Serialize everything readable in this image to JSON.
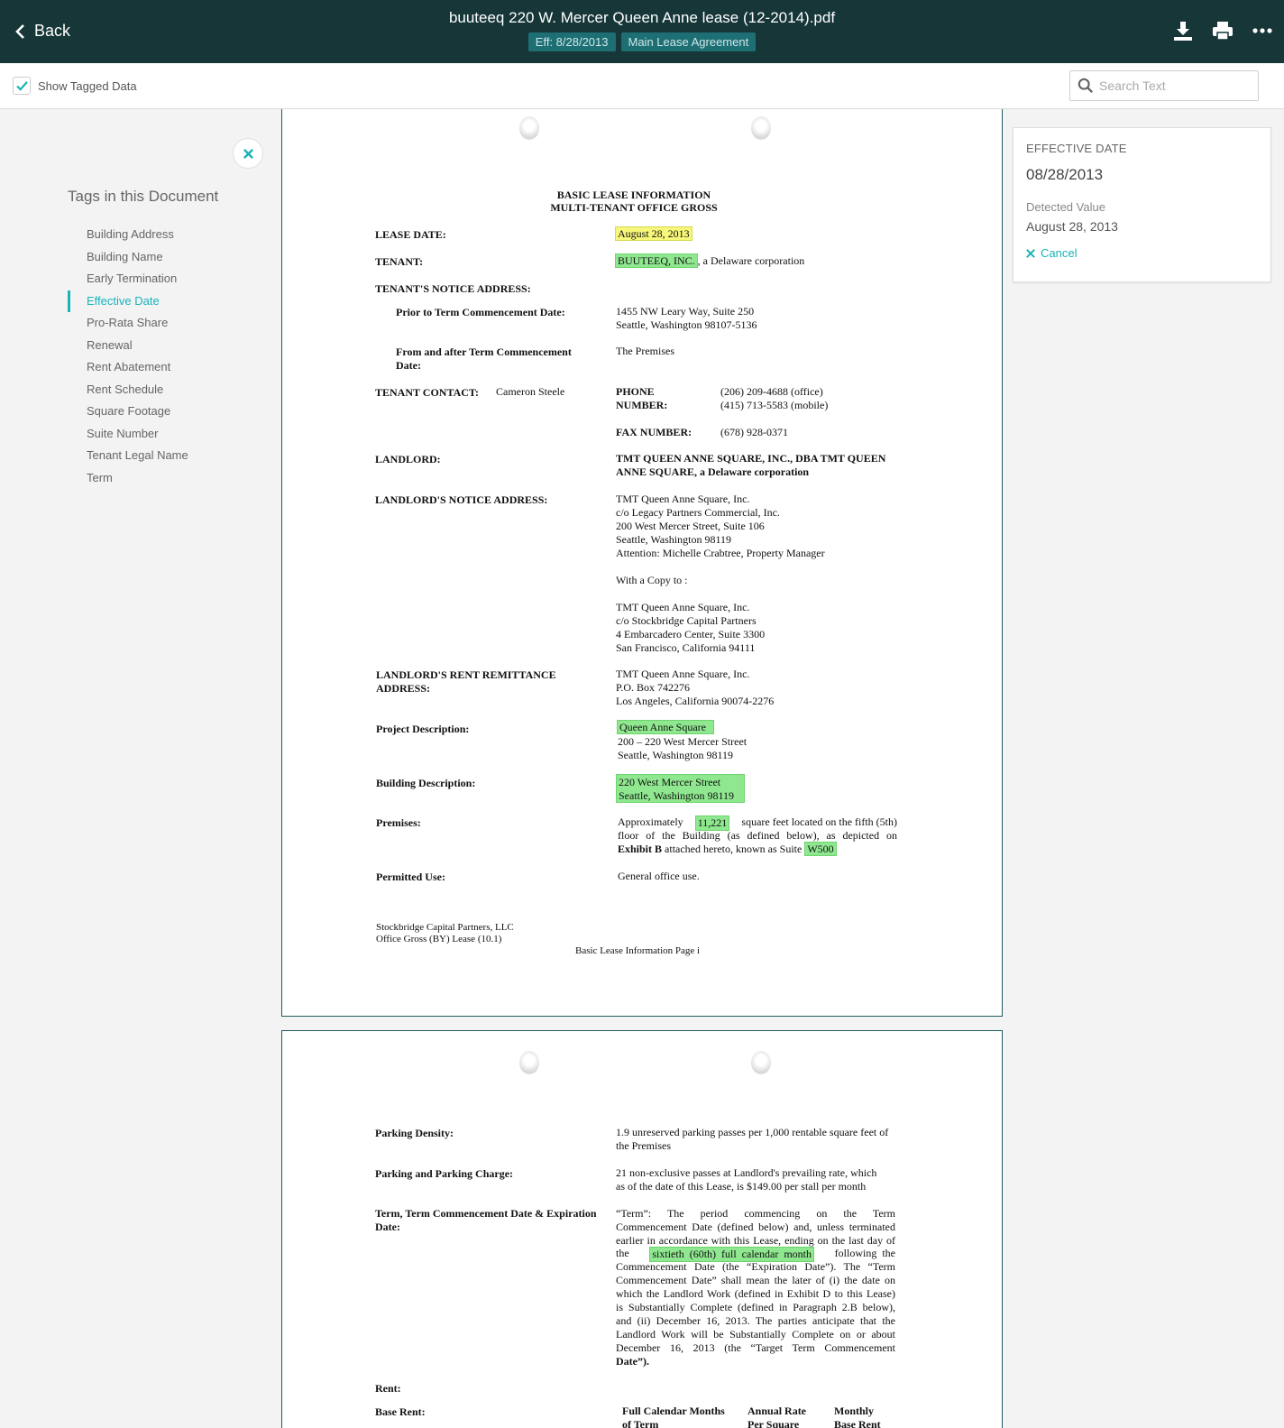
{
  "header": {
    "back_label": "Back",
    "title": "buuteeq 220 W. Mercer Queen Anne lease (12-2014).pdf",
    "chip_eff": "Eff: 8/28/2013",
    "chip_type": "Main Lease Agreement",
    "icons": [
      "download-icon",
      "print-icon",
      "more-icon"
    ]
  },
  "toolbar": {
    "show_tagged_label": "Show Tagged Data",
    "show_tagged_checked": true,
    "search_placeholder": "Search Text"
  },
  "sidebar": {
    "heading": "Tags in this Document",
    "active_index": 3,
    "items": [
      {
        "label": "Building Address"
      },
      {
        "label": "Building Name"
      },
      {
        "label": "Early Termination"
      },
      {
        "label": "Effective Date"
      },
      {
        "label": "Pro-Rata Share"
      },
      {
        "label": "Renewal"
      },
      {
        "label": "Rent Abatement"
      },
      {
        "label": "Rent Schedule"
      },
      {
        "label": "Square Footage"
      },
      {
        "label": "Suite Number"
      },
      {
        "label": "Tenant Legal Name"
      },
      {
        "label": "Term"
      }
    ]
  },
  "detail": {
    "label": "EFFECTIVE DATE",
    "value": "08/28/2013",
    "detected_label": "Detected Value",
    "detected_value": "August 28, 2013",
    "cancel_label": "Cancel"
  },
  "colors": {
    "header_bg": "#163638",
    "accent": "#19b3b8",
    "highlight_yellow": "#f7f77a",
    "highlight_green": "#8fe88f"
  },
  "doc": {
    "page1": {
      "title1": "BASIC LEASE INFORMATION",
      "title2": "MULTI-TENANT OFFICE GROSS",
      "lease_date_label": "LEASE DATE:",
      "lease_date_value": "August 28, 2013",
      "tenant_label": "TENANT:",
      "tenant_name": "BUUTEEQ, INC.",
      "tenant_rest": ", a Delaware corporation",
      "notice_label": "TENANT'S NOTICE ADDRESS:",
      "prior_label": "Prior to Term Commencement Date:",
      "prior_addr1": "1455 NW Leary Way, Suite 250",
      "prior_addr2": "Seattle, Washington 98107-5136",
      "after_label1": "From and after Term Commencement",
      "after_label2": "Date:",
      "after_value": "The Premises",
      "contact_label": "TENANT CONTACT:",
      "contact_name": "Cameron Steele",
      "phone_label1": "PHONE",
      "phone_label2": "NUMBER:",
      "phone1": "(206) 209-4688 (office)",
      "phone2": "(415) 713-5583 (mobile)",
      "fax_label": "FAX NUMBER:",
      "fax": "(678) 928-0371",
      "landlord_label": "LANDLORD:",
      "landlord1": "TMT QUEEN ANNE SQUARE, INC., DBA TMT QUEEN",
      "landlord2": "ANNE SQUARE, a Delaware corporation",
      "ll_notice_label": "LANDLORD'S NOTICE ADDRESS:",
      "ll_notice_lines": [
        "TMT Queen Anne Square, Inc.",
        "c/o Legacy Partners Commercial, Inc.",
        "200 West Mercer Street, Suite 106",
        "Seattle, Washington 98119",
        "Attention:  Michelle Crabtree, Property Manager"
      ],
      "copy_label": "With a Copy to :",
      "copy_lines": [
        "TMT Queen Anne Square, Inc.",
        "c/o Stockbridge Capital Partners",
        "4 Embarcadero Center, Suite 3300",
        "San Francisco, California 94111"
      ],
      "remit_label1": "LANDLORD'S RENT REMITTANCE",
      "remit_label2": "ADDRESS:",
      "remit_lines": [
        "TMT Queen Anne Square, Inc.",
        "P.O. Box 742276",
        "Los Angeles, California 90074-2276"
      ],
      "project_label": "Project Description:",
      "project_name": "Queen Anne Square",
      "project_line2": "200 – 220 West Mercer Street",
      "project_line3": "Seattle, Washington 98119",
      "building_label": "Building Description:",
      "building_line1": "220 West Mercer Street",
      "building_line2": "Seattle, Washington 98119",
      "premises_label": "Premises:",
      "premises_a": "Approximately",
      "premises_sqft": "11,221",
      "premises_b": "square feet located on the fifth (5th)",
      "premises_line2": "floor of the Building (as defined below), as depicted on",
      "premises_c_bold": "Exhibit B",
      "premises_c": "attached hereto, known as Suite",
      "premises_suite": "W500",
      "use_label": "Permitted Use:",
      "use_value": "General office use.",
      "footer1": "Stockbridge Capital Partners, LLC",
      "footer2": "Office Gross (BY) Lease (10.1)",
      "footer_page": "Basic Lease Information Page i"
    },
    "page2": {
      "parking_density_label": "Parking Density:",
      "parking_density_1": "1.9 unreserved parking passes per 1,000 rentable square feet of",
      "parking_density_2": "the Premises",
      "parking_charge_label": "Parking and Parking Charge:",
      "parking_charge_1": "21 non-exclusive passes at Landlord's prevailing rate, which",
      "parking_charge_2": "as of the date of this Lease, is $149.00 per stall per month",
      "term_label1": "Term, Term Commencement Date & Expiration",
      "term_label2": "Date:",
      "term_1": "“Term”:  The  period  commencing  on  the  Term",
      "term_2": "Commencement Date (defined below) and, unless terminated",
      "term_3": "earlier in accordance with this Lease, ending on the last day of",
      "term_4a": "the",
      "term_4_hl": "sixtieth  (60th)  full  calendar  month",
      "term_4b": "following  the",
      "term_5": "Commencement Date (the “Expiration Date”).  The “Term",
      "term_6": "Commencement Date” shall mean the later of (i) the date on",
      "term_7": "which the Landlord Work (defined in Exhibit D to this Lease)",
      "term_8": "is Substantially Complete (defined in Paragraph 2.B below),",
      "term_9": "and (ii) December 16, 2013.  The parties anticipate that the",
      "term_10": "Landlord Work will be Substantially Complete on or about",
      "term_11": "December 16, 2013 (the “Target Term Commencement",
      "term_12": "Date”).",
      "rent_label": "Rent:",
      "base_rent_label": "Base Rent:",
      "col1a": "Full Calendar Months",
      "col1b": "of Term",
      "col2a": "Annual Rate",
      "col2b": "Per Square",
      "col3a": "Monthly",
      "col3b": "Base Rent"
    }
  }
}
